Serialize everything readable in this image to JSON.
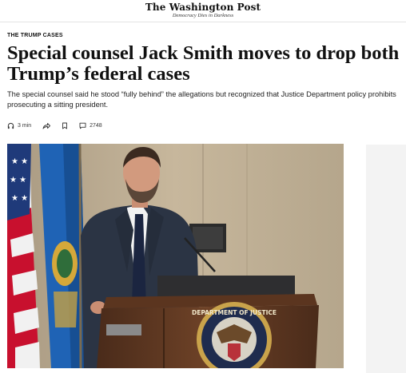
{
  "header": {
    "masthead": "The Washington Post",
    "tagline": "Democracy Dies in Darkness"
  },
  "article": {
    "kicker": "THE TRUMP CASES",
    "headline": "Special counsel Jack Smith moves to drop both Trump’s federal cases",
    "dek": "The special counsel said he stood “fully behind” the allegations but recognized that Justice Department policy prohibits prosecuting a sitting president.",
    "meta": {
      "listen_time": "3 min",
      "comment_count": "2748"
    },
    "photo": {
      "seal_text": "DEPARTMENT OF JUSTICE"
    }
  },
  "icons": {
    "listen": "headphones-icon",
    "share": "share-icon",
    "save": "bookmark-icon",
    "comments": "comment-icon"
  },
  "colors": {
    "text": "#111111",
    "rule": "#e3e3e3",
    "ad_placeholder": "#f3f3f3"
  }
}
